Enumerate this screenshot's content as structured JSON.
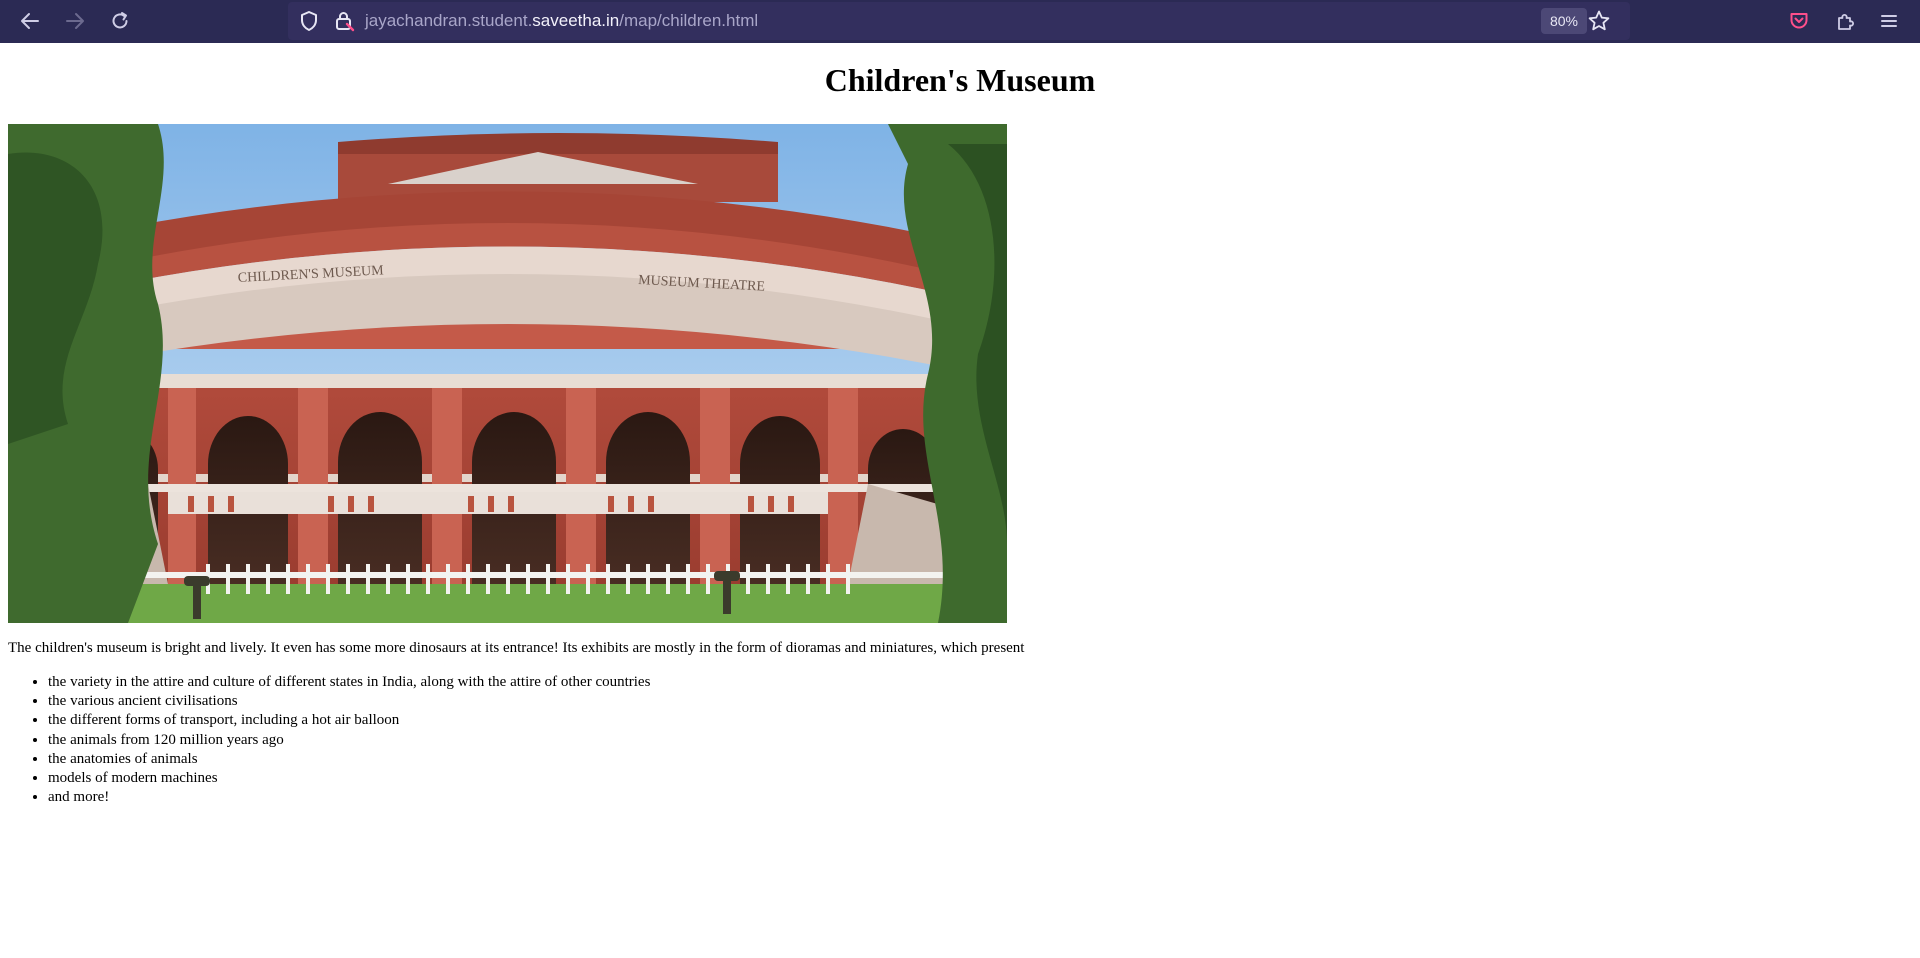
{
  "browser": {
    "url": {
      "prefix": "jayachandran.student.",
      "domain": "saveetha.in",
      "path": "/map/children.html"
    },
    "zoom": "80%",
    "icons": [
      "back-arrow-icon",
      "forward-arrow-icon",
      "reload-icon",
      "shield-icon",
      "lock-icon",
      "star-icon",
      "pocket-icon",
      "extensions-icon",
      "menu-icon"
    ],
    "colors": {
      "toolbar": "#2b2a54",
      "urlbar": "#332f5e",
      "accent": "#ff4f8b"
    }
  },
  "page": {
    "title": "Children's Museum",
    "intro": "The children's museum is bright and lively. It even has some more dinosaurs at its entrance! Its exhibits are mostly in the form of dioramas and miniatures, which present",
    "exhibits": [
      "the variety in the attire and culture of different states in India, along with the attire of other countries",
      "the various ancient civilisations",
      "the different forms of transport, including a hot air balloon",
      "the animals from 120 million years ago",
      "the anatomies of animals",
      "models of modern machines",
      "and more!"
    ],
    "photo": {
      "subject": "red-brick museum building with arched colonnade",
      "sign_left": "CHILDREN'S MUSEUM",
      "sign_right": "MUSEUM THEATRE"
    }
  }
}
